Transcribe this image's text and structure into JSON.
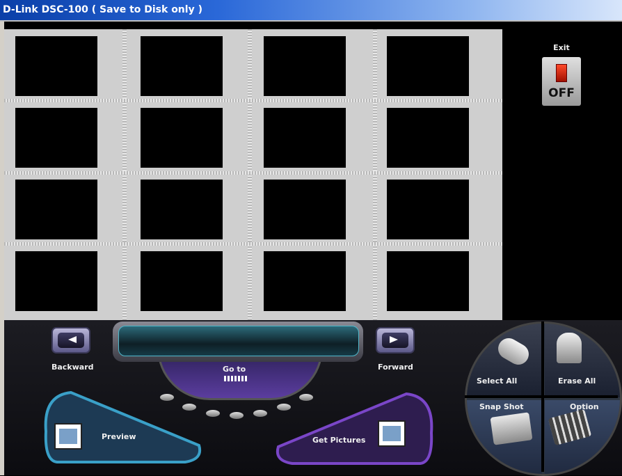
{
  "window": {
    "title": "D-Link DSC-100 ( Save to Disk only )"
  },
  "exit": {
    "label": "Exit",
    "switch_text": "OFF"
  },
  "navigation": {
    "backward_label": "Backward",
    "forward_label": "Forward",
    "goto_label": "Go to"
  },
  "actions": {
    "preview_label": "Preview",
    "get_pictures_label": "Get Pictures"
  },
  "dial": {
    "select_all_label": "Select All",
    "erase_all_label": "Erase All",
    "snap_shot_label": "Snap Shot",
    "option_label": "Option"
  },
  "icons": [
    "exit-switch-icon",
    "backward-arrow-icon",
    "forward-arrow-icon",
    "goto-arrow-icon",
    "preview-film-icon",
    "get-pictures-film-icon",
    "mouse-icon",
    "trash-can-icon",
    "camera-icon",
    "keypad-icon"
  ],
  "colors": {
    "titlebar_start": "#0a3fa8",
    "titlebar_end": "#d8e6fb",
    "preview_accent": "#3aa0c8",
    "get_pictures_accent": "#7a46c8",
    "grid_bg": "#cfcfcf"
  }
}
